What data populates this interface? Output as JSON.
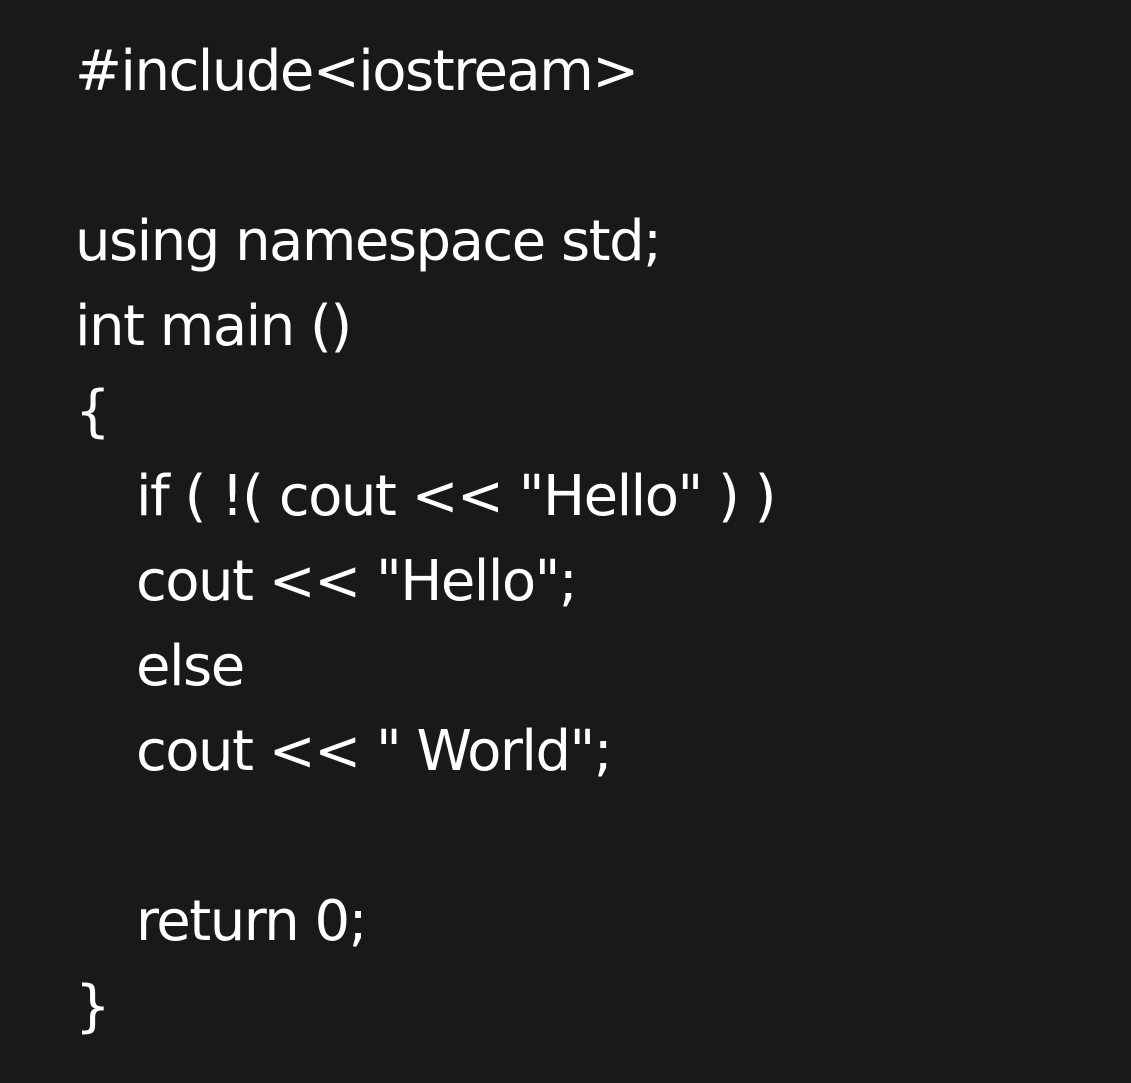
{
  "code": {
    "lines": [
      "#include<iostream>",
      "using namespace std;",
      "int main ()",
      "{",
      "if ( !( cout << \"Hello\" ) )",
      "cout << \"Hello\";",
      "else",
      "cout << \" World\";",
      "return 0;",
      "}"
    ],
    "background_color": "#191919",
    "text_color": "#ffffff"
  }
}
